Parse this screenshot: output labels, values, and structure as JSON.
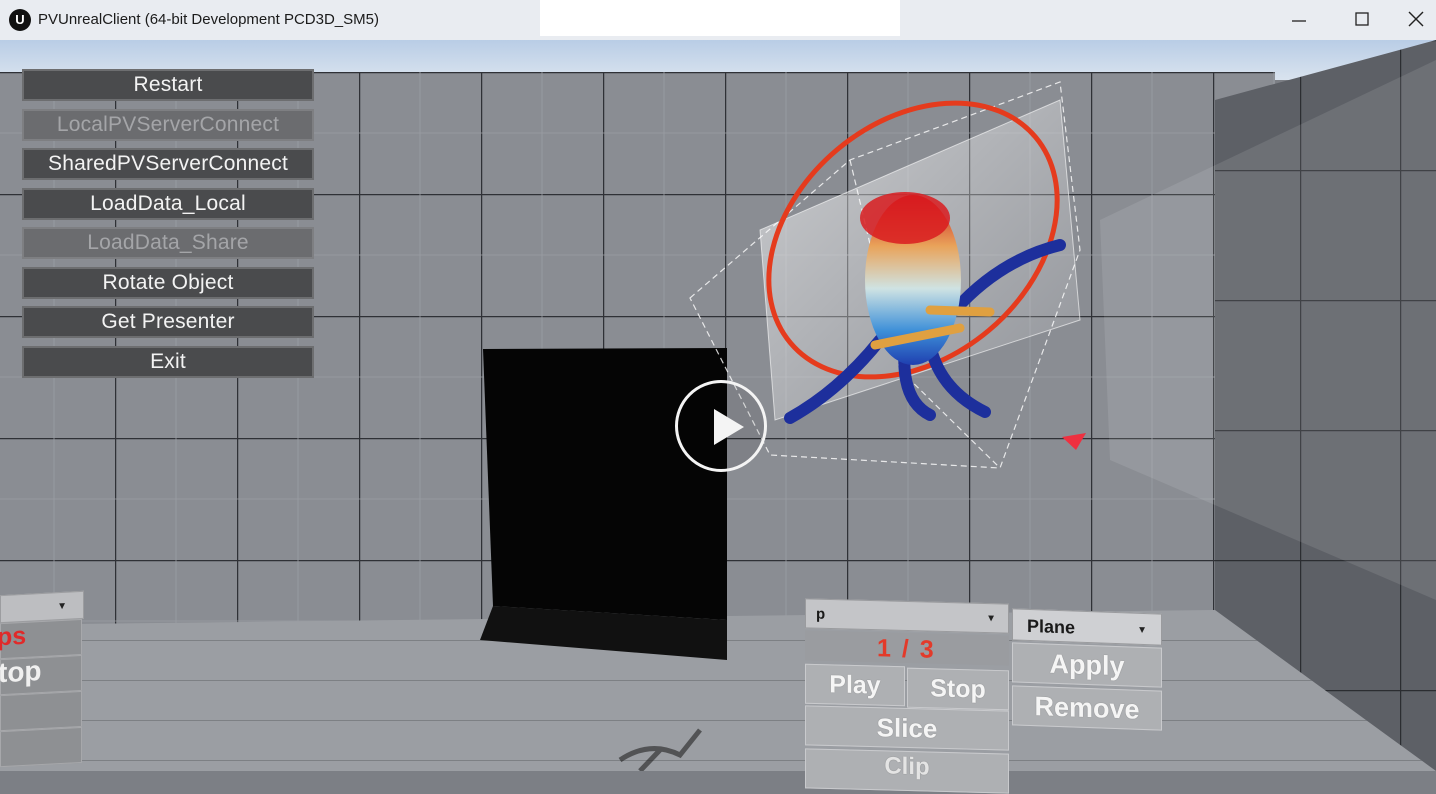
{
  "window": {
    "title": "PVUnrealClient (64-bit Development PCD3D_SM5)",
    "logo_glyph": "U",
    "minimize_icon": "minimize-icon",
    "maximize_icon": "maximize-icon",
    "close_icon": "close-icon"
  },
  "menu": {
    "items": [
      {
        "label": "Restart",
        "enabled": true
      },
      {
        "label": "LocalPVServerConnect",
        "enabled": false
      },
      {
        "label": "SharedPVServerConnect",
        "enabled": true
      },
      {
        "label": "LoadData_Local",
        "enabled": true
      },
      {
        "label": "LoadData_Share",
        "enabled": false
      },
      {
        "label": "Rotate Object",
        "enabled": true
      },
      {
        "label": "Get Presenter",
        "enabled": true
      },
      {
        "label": "Exit",
        "enabled": true
      }
    ]
  },
  "video": {
    "play_icon": "play-icon"
  },
  "left_panel": {
    "steps_label": "ps",
    "stop_label": "top"
  },
  "control_panel": {
    "array_dropdown_value": "p",
    "filter_dropdown_value": "Plane",
    "timestep_counter": "1 / 3",
    "play_label": "Play",
    "stop_label": "Stop",
    "slice_label": "Slice",
    "clip_label": "Clip",
    "apply_label": "Apply",
    "remove_label": "Remove"
  },
  "colors": {
    "accent_red": "#e33a2a",
    "menu_button_bg": "#4a4b4d",
    "panel_button_bg": "#aeb0b3"
  }
}
